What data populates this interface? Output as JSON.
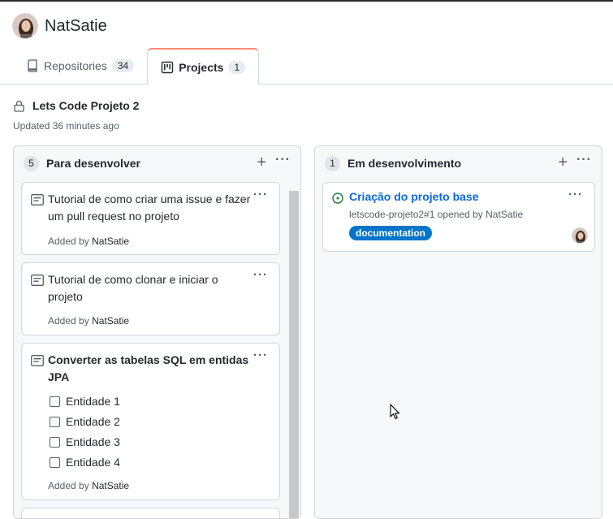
{
  "user": {
    "name": "NatSatie"
  },
  "tabs": [
    {
      "label": "Repositories",
      "count": "34",
      "icon": "repo-icon"
    },
    {
      "label": "Projects",
      "count": "1",
      "icon": "project-icon"
    }
  ],
  "project": {
    "title": "Lets Code Projeto 2",
    "updated": "Updated 36 minutes ago",
    "icon": "lock-icon"
  },
  "columns": [
    {
      "name": "Para desenvolver",
      "count": "5",
      "add": "+",
      "more": "···",
      "cards": [
        {
          "title": "Tutorial de como criar uma issue e fazer um pull request no projeto",
          "added_prefix": "Added by",
          "added_by": "NatSatie",
          "more": "···"
        },
        {
          "title": "Tutorial de como clonar e iniciar o projeto",
          "added_prefix": "Added by",
          "added_by": "NatSatie",
          "more": "···"
        },
        {
          "title": "Converter as tabelas SQL em entidas JPA",
          "tasks": [
            "Entidade 1",
            "Entidade 2",
            "Entidade 3",
            "Entidade 4"
          ],
          "added_prefix": "Added by",
          "added_by": "NatSatie",
          "more": "···"
        }
      ]
    },
    {
      "name": "Em desenvolvimento",
      "count": "1",
      "add": "+",
      "more": "···",
      "cards": [
        {
          "title": "Criação do projeto base",
          "meta_ref": "letscode-projeto2#1 opened by",
          "meta_user": "NatSatie",
          "label": "documentation",
          "label_color": "#0075ca",
          "more": "···"
        }
      ]
    }
  ],
  "colors": {
    "accent": "#0969da",
    "tab_active": "#fd8c73",
    "open_issue": "#1a7f37"
  }
}
